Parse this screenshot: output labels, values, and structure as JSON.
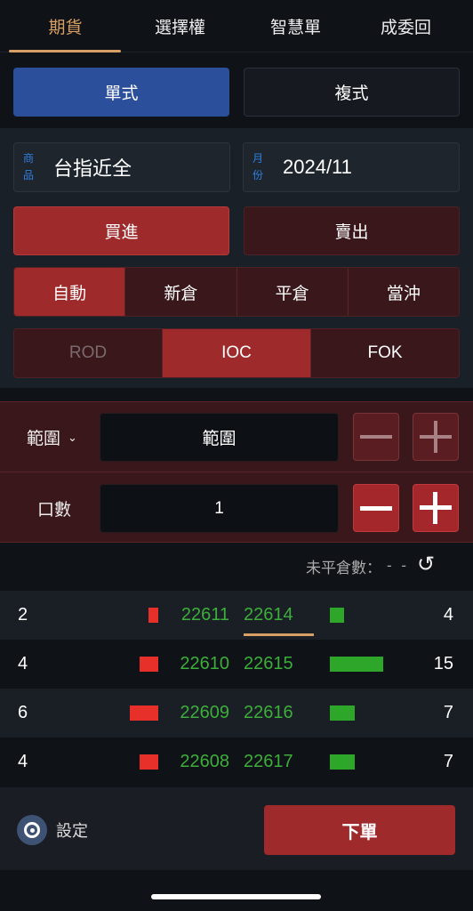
{
  "tabs": [
    {
      "label": "期貨",
      "active": true
    },
    {
      "label": "選擇權"
    },
    {
      "label": "智慧單"
    },
    {
      "label": "成委回"
    }
  ],
  "order_mode": {
    "single": "單式",
    "combo": "複式",
    "selected": "單式"
  },
  "product": {
    "label": "商品",
    "value": "台指近全"
  },
  "month": {
    "label": "月份",
    "value": "2024/11"
  },
  "side": {
    "buy": "買進",
    "sell": "賣出",
    "selected": "買進"
  },
  "position_type": {
    "options": [
      "自動",
      "新倉",
      "平倉",
      "當沖"
    ],
    "selected": "自動"
  },
  "time_in_force": {
    "options": [
      "ROD",
      "IOC",
      "FOK"
    ],
    "selected": "IOC",
    "disabled": [
      "ROD"
    ]
  },
  "price": {
    "label": "範圍",
    "value": "範圍"
  },
  "quantity": {
    "label": "口數",
    "value": "1"
  },
  "open_position": {
    "label": "未平倉數：",
    "value": "- -"
  },
  "order_book": [
    {
      "bid_qty": "2",
      "bid": "22611",
      "ask": "22614",
      "ask_qty": "4"
    },
    {
      "bid_qty": "4",
      "bid": "22610",
      "ask": "22615",
      "ask_qty": "15"
    },
    {
      "bid_qty": "6",
      "bid": "22609",
      "ask": "22616",
      "ask_qty": "7"
    },
    {
      "bid_qty": "4",
      "bid": "22608",
      "ask": "22617",
      "ask_qty": "7"
    }
  ],
  "footer": {
    "settings": "設定",
    "submit": "下單"
  },
  "colors": {
    "accent": "#d9a066",
    "blue": "#2b4f9a",
    "buy_red": "#9e2a2b",
    "bid_bar": "#e8302a",
    "ask_bar": "#2ea62a",
    "price_green": "#3cae3a"
  }
}
